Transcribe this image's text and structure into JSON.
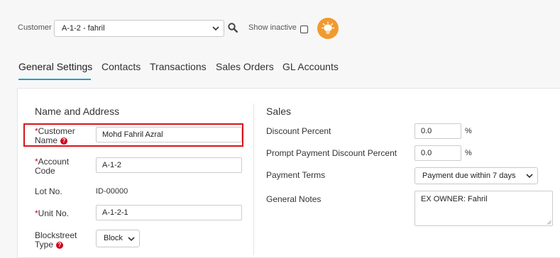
{
  "toolbar": {
    "customer_label": "Customer",
    "customer_value": "A-1-2 - fahril",
    "show_inactive_label": "Show inactive"
  },
  "tabs": [
    {
      "label": "General Settings",
      "active": true
    },
    {
      "label": "Contacts"
    },
    {
      "label": "Transactions"
    },
    {
      "label": "Sales Orders"
    },
    {
      "label": "GL Accounts"
    }
  ],
  "name_address": {
    "title": "Name and Address",
    "customer_name": {
      "label_line1": "Customer",
      "label_line2": "Name",
      "required": "*",
      "value": "Mohd Fahril Azral"
    },
    "account_code": {
      "label_line1": "Account",
      "label_line2": "Code",
      "required": "*",
      "value": "A-1-2"
    },
    "lot_no": {
      "label": "Lot No.",
      "value": "ID-00000"
    },
    "unit_no": {
      "label": "Unit No.",
      "required": "*",
      "value": "A-1-2-1"
    },
    "blockstreet_type": {
      "label_line1": "Blockstreet",
      "label_line2": "Type",
      "value": "Block"
    }
  },
  "sales": {
    "title": "Sales",
    "discount_percent": {
      "label": "Discount Percent",
      "value": "0.0",
      "unit": "%"
    },
    "prompt_payment_discount": {
      "label": "Prompt Payment Discount Percent",
      "value": "0.0",
      "unit": "%"
    },
    "payment_terms": {
      "label": "Payment Terms",
      "value": "Payment due within 7 days"
    },
    "general_notes": {
      "label": "General Notes",
      "value": "EX OWNER: Fahril"
    }
  },
  "colors": {
    "accent": "#1aa3c0",
    "highlight": "#d8141b",
    "required": "#d0021b",
    "bulb": "#f19a2f"
  }
}
